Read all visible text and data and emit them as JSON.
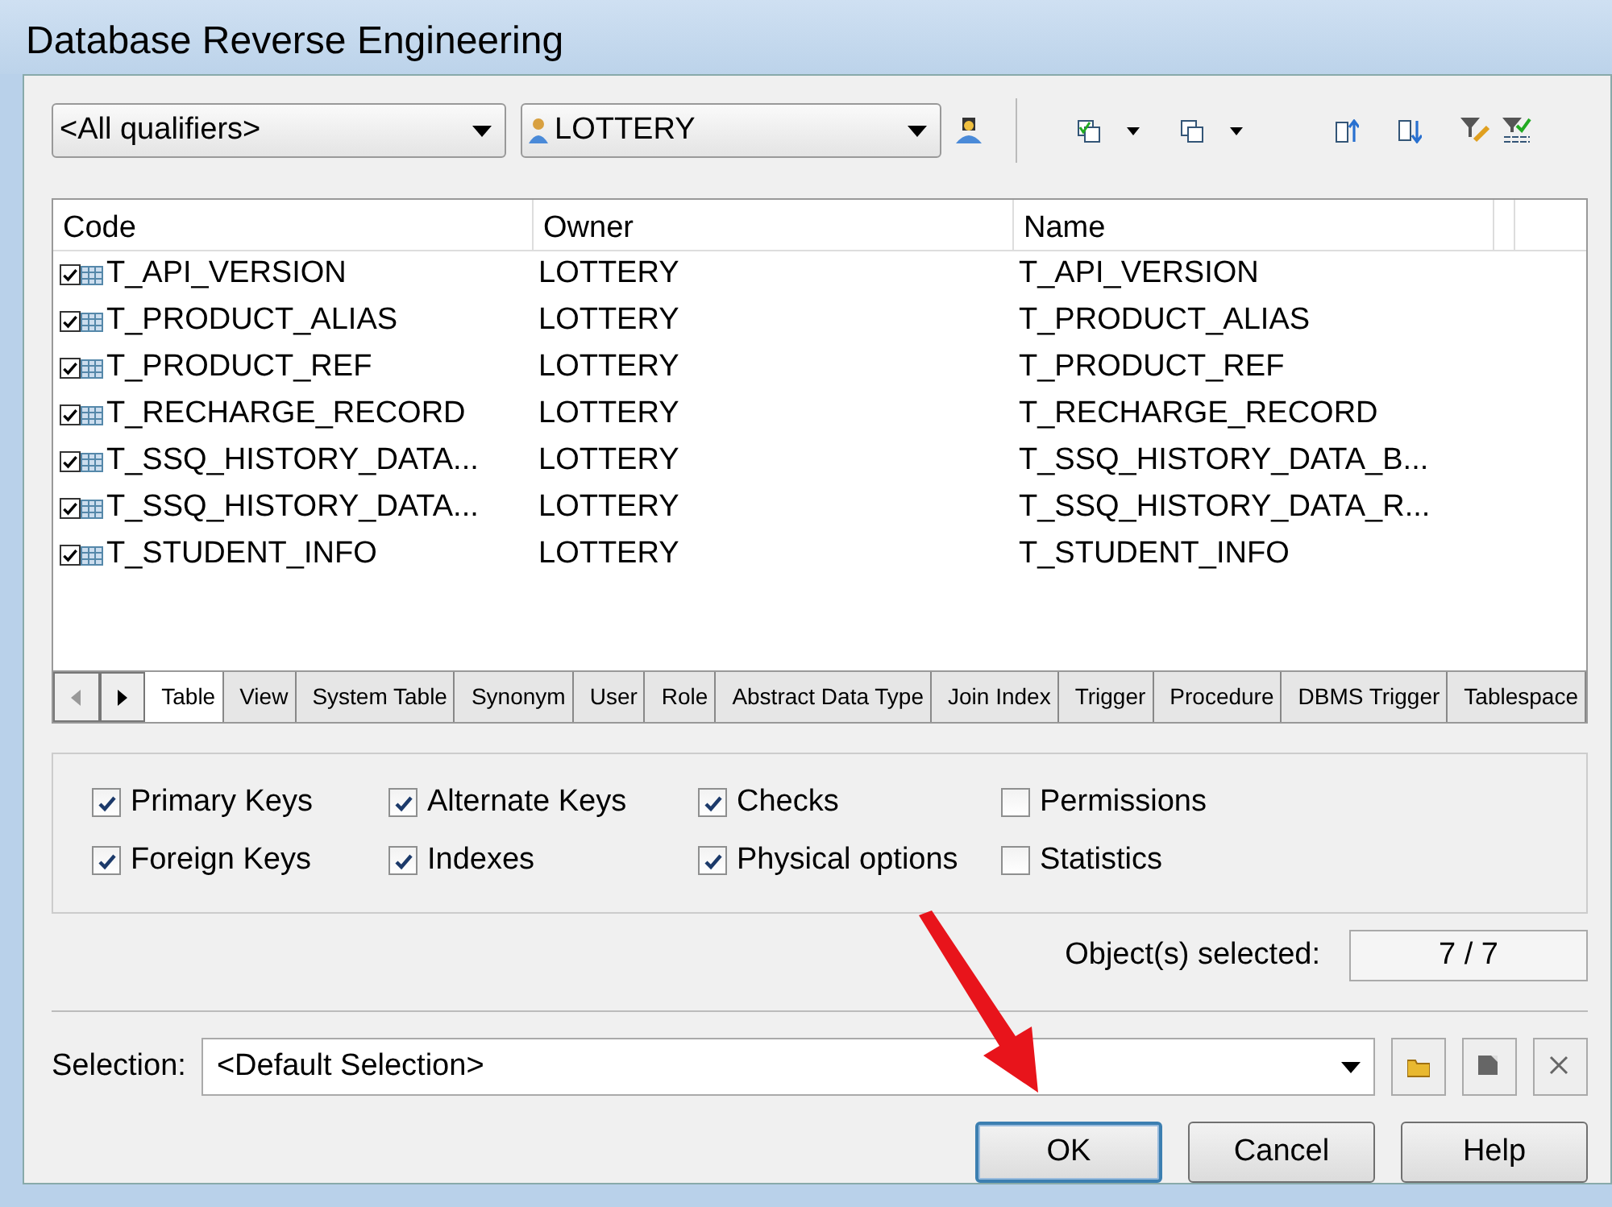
{
  "window": {
    "title": "Database Reverse Engineering"
  },
  "toolbar": {
    "qualifier": "<All qualifiers>",
    "owner": "LOTTERY"
  },
  "table": {
    "columns": [
      "Code",
      "Owner",
      "Name"
    ],
    "rows": [
      {
        "code": "T_API_VERSION",
        "owner": "LOTTERY",
        "name": "T_API_VERSION",
        "checked": true
      },
      {
        "code": "T_PRODUCT_ALIAS",
        "owner": "LOTTERY",
        "name": "T_PRODUCT_ALIAS",
        "checked": true
      },
      {
        "code": "T_PRODUCT_REF",
        "owner": "LOTTERY",
        "name": "T_PRODUCT_REF",
        "checked": true
      },
      {
        "code": "T_RECHARGE_RECORD",
        "owner": "LOTTERY",
        "name": "T_RECHARGE_RECORD",
        "checked": true
      },
      {
        "code": "T_SSQ_HISTORY_DATA...",
        "owner": "LOTTERY",
        "name": "T_SSQ_HISTORY_DATA_B...",
        "checked": true
      },
      {
        "code": "T_SSQ_HISTORY_DATA...",
        "owner": "LOTTERY",
        "name": "T_SSQ_HISTORY_DATA_R...",
        "checked": true
      },
      {
        "code": "T_STUDENT_INFO",
        "owner": "LOTTERY",
        "name": "T_STUDENT_INFO",
        "checked": true
      }
    ]
  },
  "tabs": [
    {
      "label": "Table",
      "selected": true
    },
    {
      "label": "View",
      "selected": false
    },
    {
      "label": "System Table",
      "selected": false
    },
    {
      "label": "Synonym",
      "selected": false
    },
    {
      "label": "User",
      "selected": false
    },
    {
      "label": "Role",
      "selected": false
    },
    {
      "label": "Abstract Data Type",
      "selected": false
    },
    {
      "label": "Join Index",
      "selected": false
    },
    {
      "label": "Trigger",
      "selected": false
    },
    {
      "label": "Procedure",
      "selected": false
    },
    {
      "label": "DBMS Trigger",
      "selected": false
    },
    {
      "label": "Tablespace",
      "selected": false
    }
  ],
  "options": [
    {
      "label": "Primary Keys",
      "checked": true
    },
    {
      "label": "Alternate Keys",
      "checked": true
    },
    {
      "label": "Checks",
      "checked": true
    },
    {
      "label": "Permissions",
      "checked": false
    },
    {
      "label": "Foreign Keys",
      "checked": true
    },
    {
      "label": "Indexes",
      "checked": true
    },
    {
      "label": "Physical options",
      "checked": true
    },
    {
      "label": "Statistics",
      "checked": false
    }
  ],
  "objects_selected": {
    "label": "Object(s) selected:",
    "value": "7 / 7"
  },
  "selection": {
    "label": "Selection:",
    "value": "<Default Selection>"
  },
  "buttons": [
    {
      "label": "OK",
      "default": true
    },
    {
      "label": "Cancel",
      "default": false
    },
    {
      "label": "Help",
      "default": false
    }
  ]
}
